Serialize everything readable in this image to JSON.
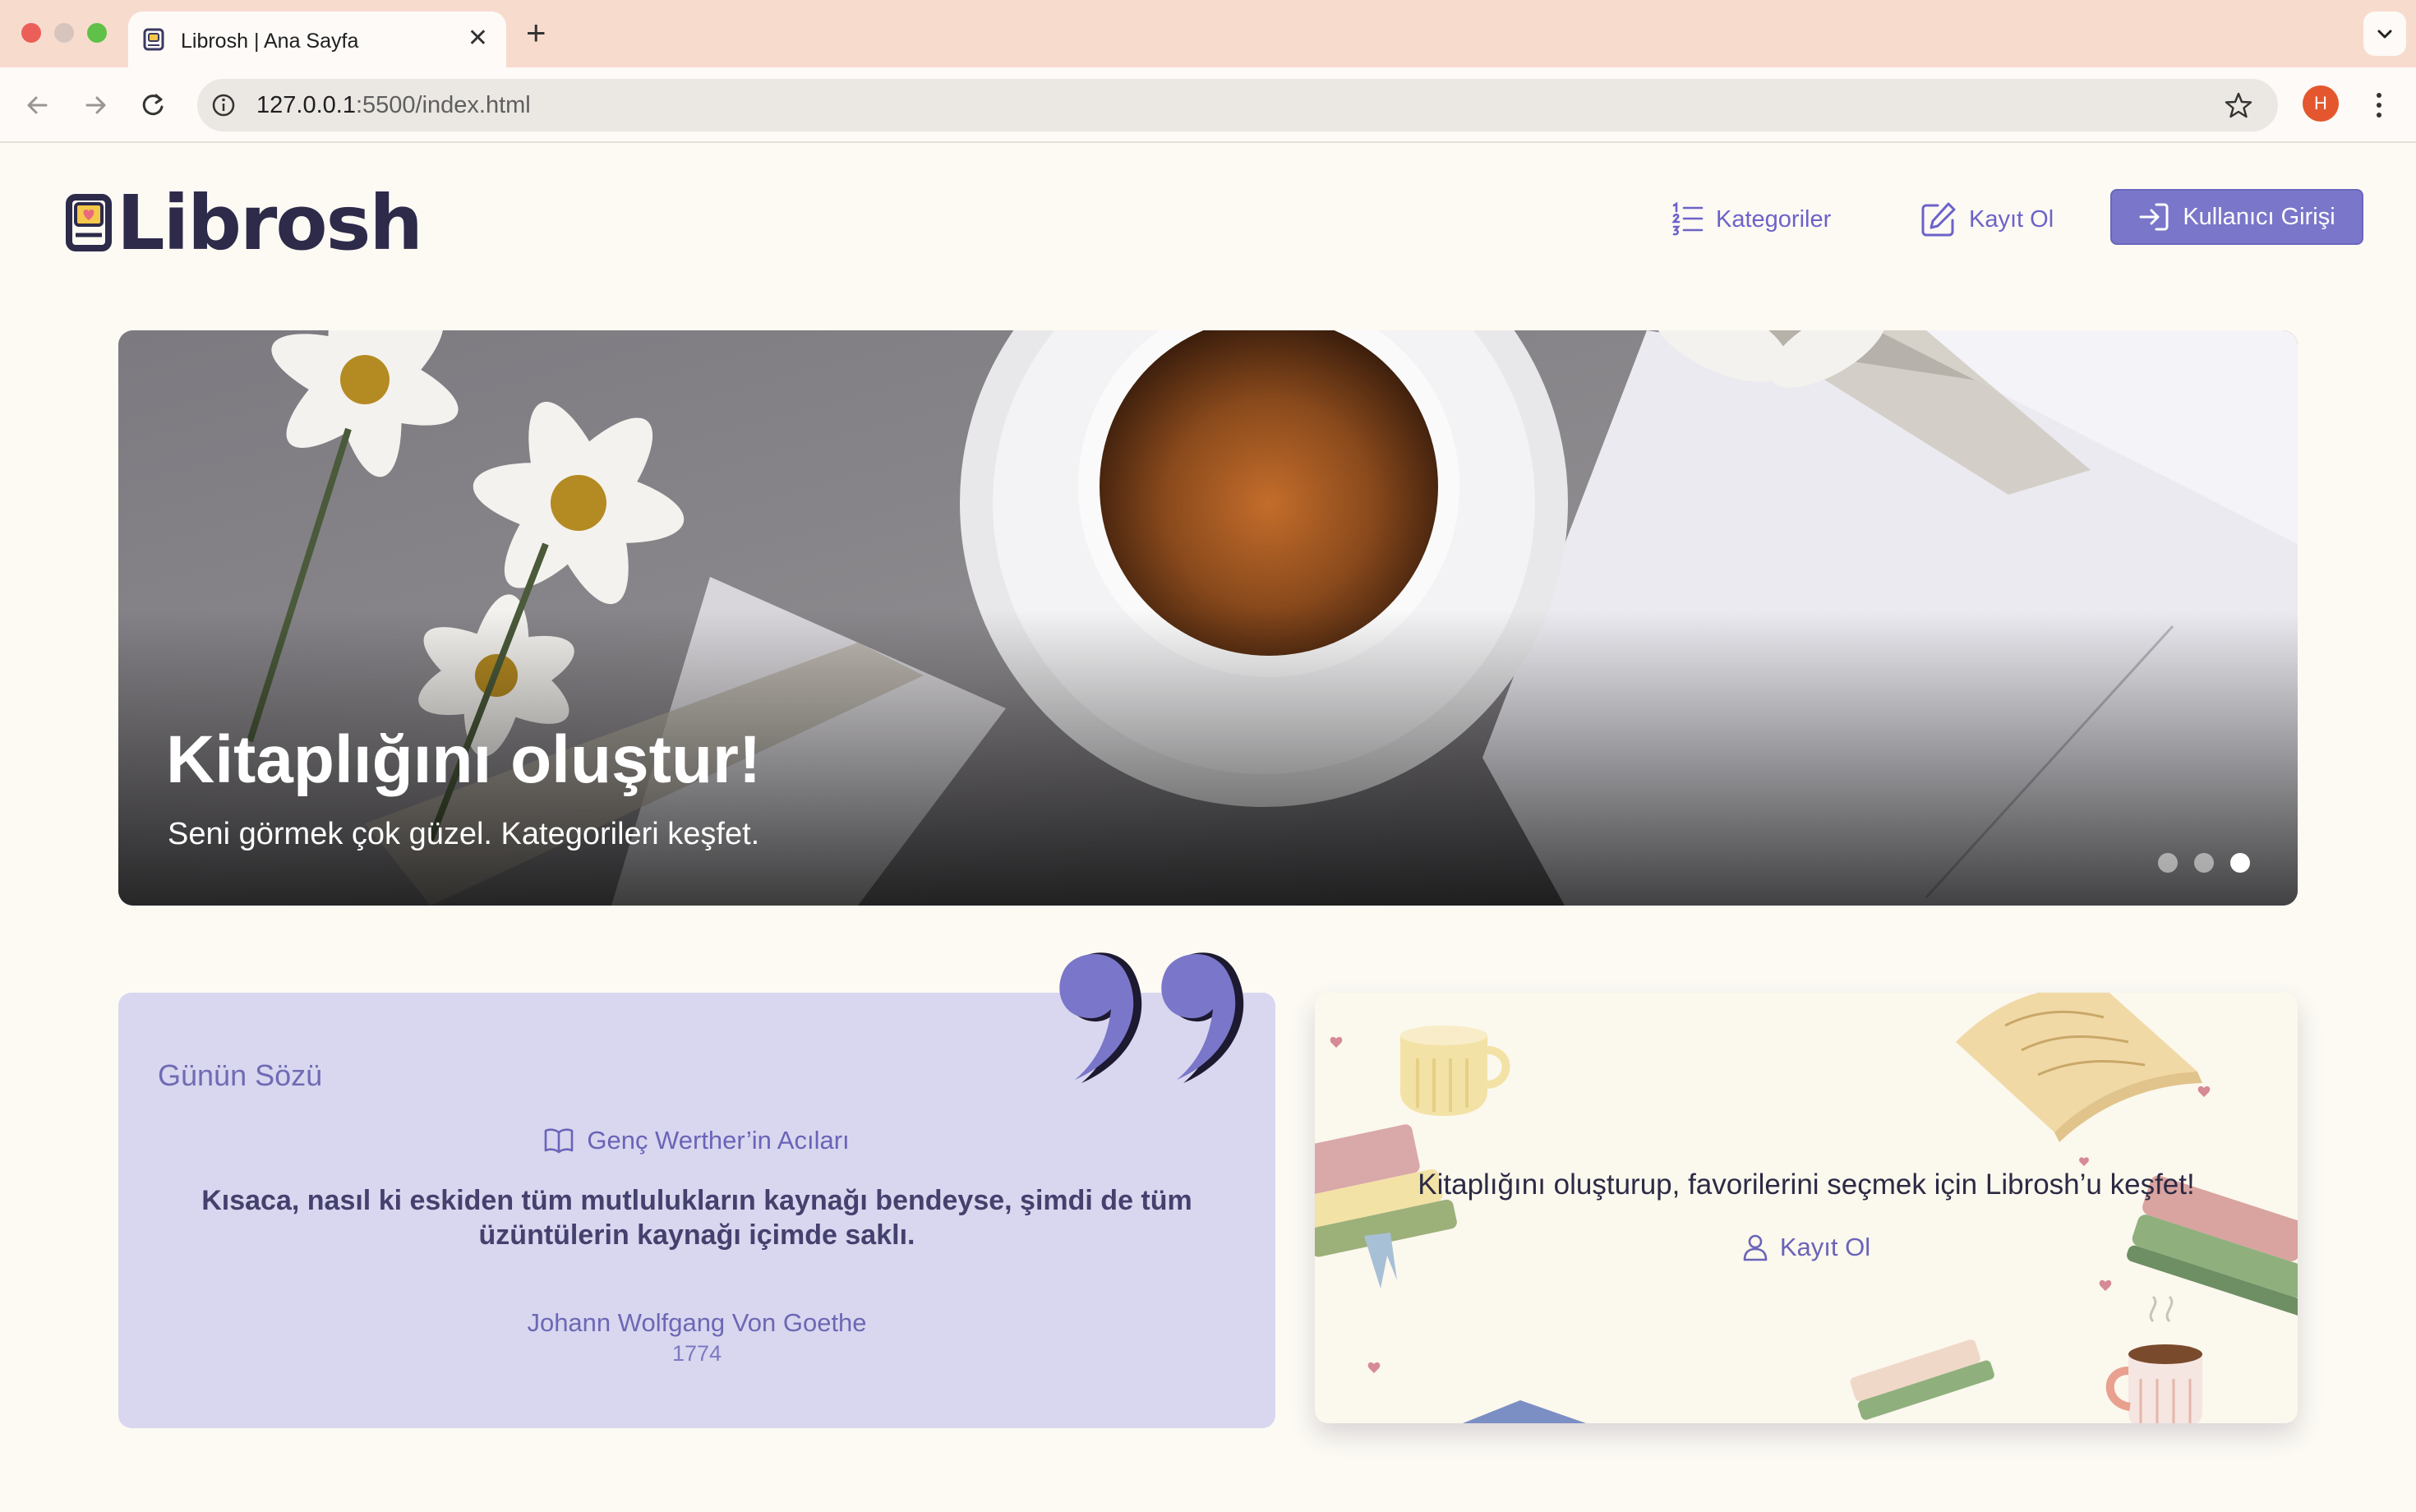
{
  "browser": {
    "tab_title": "Librosh | Ana Sayfa",
    "url_host": "127.0.0.1",
    "url_rest": ":5500/index.html",
    "avatar_letter": "H"
  },
  "header": {
    "logo": "Librosh",
    "nav": {
      "categories": "Kategoriler",
      "register": "Kayıt Ol",
      "login": "Kullanıcı Girişi"
    }
  },
  "hero": {
    "title": "Kitaplığını oluştur!",
    "subtitle": "Seni görmek çok güzel. Kategorileri keşfet.",
    "slides": 3,
    "active_slide": 3
  },
  "quote": {
    "heading": "Günün Sözü",
    "book": "Genç Werther’in Acıları",
    "text": "Kısaca, nasıl ki eskiden tüm mutlulukların kaynağı bendeyse, şimdi de tüm üzüntülerin kaynağı içimde saklı.",
    "author": "Johann Wolfgang Von Goethe",
    "year": "1774"
  },
  "promo": {
    "text": "Kitaplığını oluşturup, favorilerini seçmek için Librosh’u keşfet!",
    "link": "Kayıt Ol"
  },
  "colors": {
    "accent": "#7a76c9",
    "quote_bg": "#d9d7ef",
    "page_bg": "#fcfaf3",
    "chrome_tabbar": "#f7dccd"
  }
}
